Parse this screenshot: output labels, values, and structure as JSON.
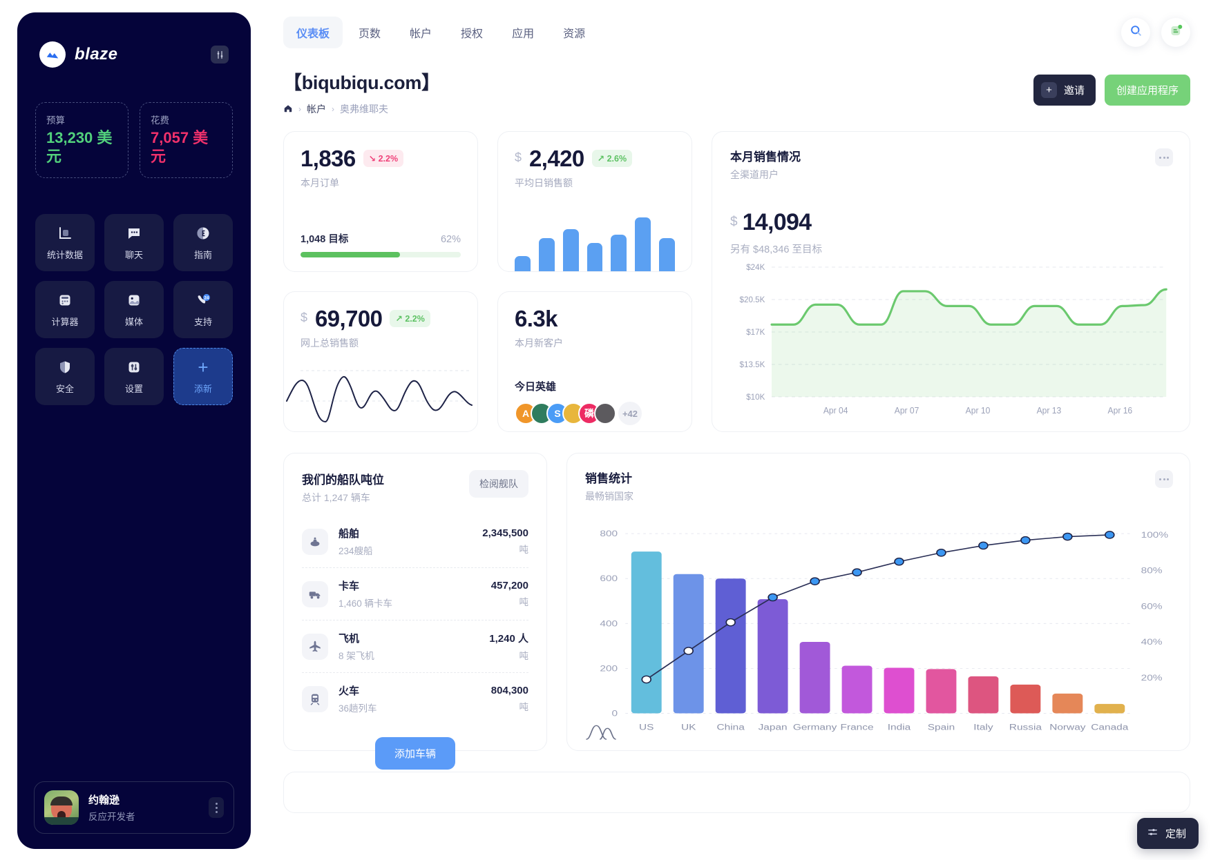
{
  "sidebar": {
    "brand_name": "blaze",
    "brand_logo_icon": "blaze-wave-logo",
    "settings_icon": "sliders-icon",
    "budget": {
      "label": "预算",
      "value": "13,230 美元",
      "color": "#52d17c"
    },
    "spend": {
      "label": "花费",
      "value": "7,057 美元",
      "color": "#f0316b"
    },
    "tiles": [
      {
        "label": "统计数据",
        "icon": "bar-chart-icon"
      },
      {
        "label": "聊天",
        "icon": "chat-bubble-icon"
      },
      {
        "label": "指南",
        "icon": "compass-icon"
      },
      {
        "label": "计算器",
        "icon": "calculator-icon"
      },
      {
        "label": "媒体",
        "icon": "image-icon"
      },
      {
        "label": "支持",
        "icon": "phone-24-icon"
      },
      {
        "label": "安全",
        "icon": "shield-icon"
      },
      {
        "label": "设置",
        "icon": "sliders-icon"
      },
      {
        "label": "添新",
        "icon": "plus-icon"
      }
    ],
    "profile": {
      "name": "约翰逊",
      "role": "反应开发者",
      "avatar_icon": "user-avatar",
      "menu_icon": "kebab-menu-icon"
    }
  },
  "topbar": {
    "tabs": [
      {
        "label": "仪表板",
        "active": true
      },
      {
        "label": "页数",
        "active": false
      },
      {
        "label": "帐户",
        "active": false
      },
      {
        "label": "授权",
        "active": false
      },
      {
        "label": "应用",
        "active": false
      },
      {
        "label": "资源",
        "active": false
      }
    ],
    "search_icon": "search-icon",
    "notes_icon": "note-badge-icon"
  },
  "page": {
    "title": "【biqubiqu.com】",
    "home_icon": "home-icon",
    "breadcrumbs": [
      "帐户",
      "奥弗维耶夫"
    ],
    "invite_label": "邀请",
    "invite_icon": "plus-icon",
    "create_label": "创建应用程序"
  },
  "kpi": {
    "orders": {
      "value": "1,836",
      "chip": "2.2%",
      "chip_dir": "down",
      "label": "本月订单",
      "goal_label": "1,048 目标",
      "goal_percent": "62%",
      "goal_value": 62
    },
    "daily_sales": {
      "currency": "$",
      "value": "2,420",
      "chip": "2.6%",
      "chip_dir": "up",
      "label": "平均日销售额",
      "bars": [
        28,
        62,
        78,
        52,
        68,
        100,
        62
      ]
    },
    "online_sales": {
      "currency": "$",
      "value": "69,700",
      "chip": "2.2%",
      "chip_dir": "up",
      "label": "网上总销售额"
    },
    "new_customers": {
      "value": "6.3k",
      "label": "本月新客户",
      "heroes_title": "今日英雄",
      "heroes": [
        {
          "initial": "A",
          "color": "#f0962a"
        },
        {
          "initial": "",
          "color": "#2f7c5e"
        },
        {
          "initial": "S",
          "color": "#4a9cf6"
        },
        {
          "initial": "",
          "color": "#e8b63c"
        },
        {
          "initial": "磷",
          "color": "#ed2b63"
        },
        {
          "initial": "",
          "color": "#5c5a5e"
        }
      ],
      "more_label": "+42"
    }
  },
  "sales_card": {
    "title": "本月销售情况",
    "subtitle": "全渠道用户",
    "currency": "$",
    "value": "14,094",
    "note": "另有 $48,346 至目标",
    "menu_icon": "ellipsis-icon"
  },
  "fleet": {
    "title": "我们的船队吨位",
    "subtitle": "总计 1,247 辆车",
    "button": "检阅舰队",
    "add_button": "添加车辆",
    "rows": [
      {
        "name": "船舶",
        "desc": "234艘船",
        "value": "2,345,500",
        "unit": "吨",
        "icon": "ship-icon"
      },
      {
        "name": "卡车",
        "desc": "1,460 辆卡车",
        "value": "457,200",
        "unit": "吨",
        "icon": "truck-icon"
      },
      {
        "name": "飞机",
        "desc": "8 架飞机",
        "value": "1,240 人",
        "unit": "吨",
        "icon": "plane-icon"
      },
      {
        "name": "火车",
        "desc": "36趟列车",
        "value": "804,300",
        "unit": "吨",
        "icon": "train-icon"
      }
    ]
  },
  "stats_card": {
    "title": "销售统计",
    "subtitle": "最畅销国家",
    "menu_icon": "ellipsis-icon",
    "legend_icon": "distribution-icon"
  },
  "customize": {
    "label": "定制",
    "icon": "tune-icon"
  },
  "chart_data": [
    {
      "type": "area",
      "title": "本月销售情况",
      "subtitle": "全渠道用户",
      "xlabel": "",
      "ylabel": "",
      "ylim": [
        10000,
        24000
      ],
      "yticks": [
        24000,
        20500,
        17000,
        13500,
        10000
      ],
      "ytick_labels": [
        "$24K",
        "$20.5K",
        "$17K",
        "$13.5K",
        "$10K"
      ],
      "xtick_labels": [
        "Apr 04",
        "Apr 07",
        "Apr 10",
        "Apr 13",
        "Apr 16"
      ],
      "grid": true,
      "line_color": "#6bc96e",
      "values": [
        17800,
        17800,
        19950,
        19950,
        17800,
        17800,
        21400,
        21400,
        19800,
        19800,
        17800,
        17800,
        19800,
        19800,
        17800,
        17800,
        19800,
        19900,
        21600
      ]
    },
    {
      "type": "bar",
      "title": "销售统计",
      "subtitle": "最畅销国家",
      "categories": [
        "US",
        "UK",
        "China",
        "Japan",
        "Germany",
        "France",
        "India",
        "Spain",
        "Italy",
        "Russia",
        "Norway",
        "Canada"
      ],
      "values": [
        720,
        620,
        600,
        508,
        318,
        212,
        203,
        197,
        165,
        128,
        88,
        42
      ],
      "ylabel": "",
      "ylim": [
        0,
        850
      ],
      "yticks": [
        0,
        200,
        400,
        600,
        800
      ],
      "ytick_labels": [
        "0",
        "200",
        "400",
        "600",
        "800"
      ],
      "series": [
        {
          "name": "cumulative",
          "type": "line",
          "axis": "right",
          "values": [
            19,
            35,
            51,
            65,
            74,
            79,
            85,
            90,
            94,
            97,
            99,
            100
          ]
        }
      ],
      "y2lim": [
        0,
        107
      ],
      "y2ticks": [
        20,
        40,
        60,
        80,
        100
      ],
      "y2tick_labels": [
        "20%",
        "40%",
        "60%",
        "80%",
        "100%"
      ],
      "bar_colors": [
        "#63bedd",
        "#6d93e8",
        "#5f5fd4",
        "#7d5bd6",
        "#a159d8",
        "#c258dc",
        "#de4fd0",
        "#e2569f",
        "#dd5580",
        "#dd5a57",
        "#e58758",
        "#e1b14d"
      ],
      "grid": true
    }
  ]
}
